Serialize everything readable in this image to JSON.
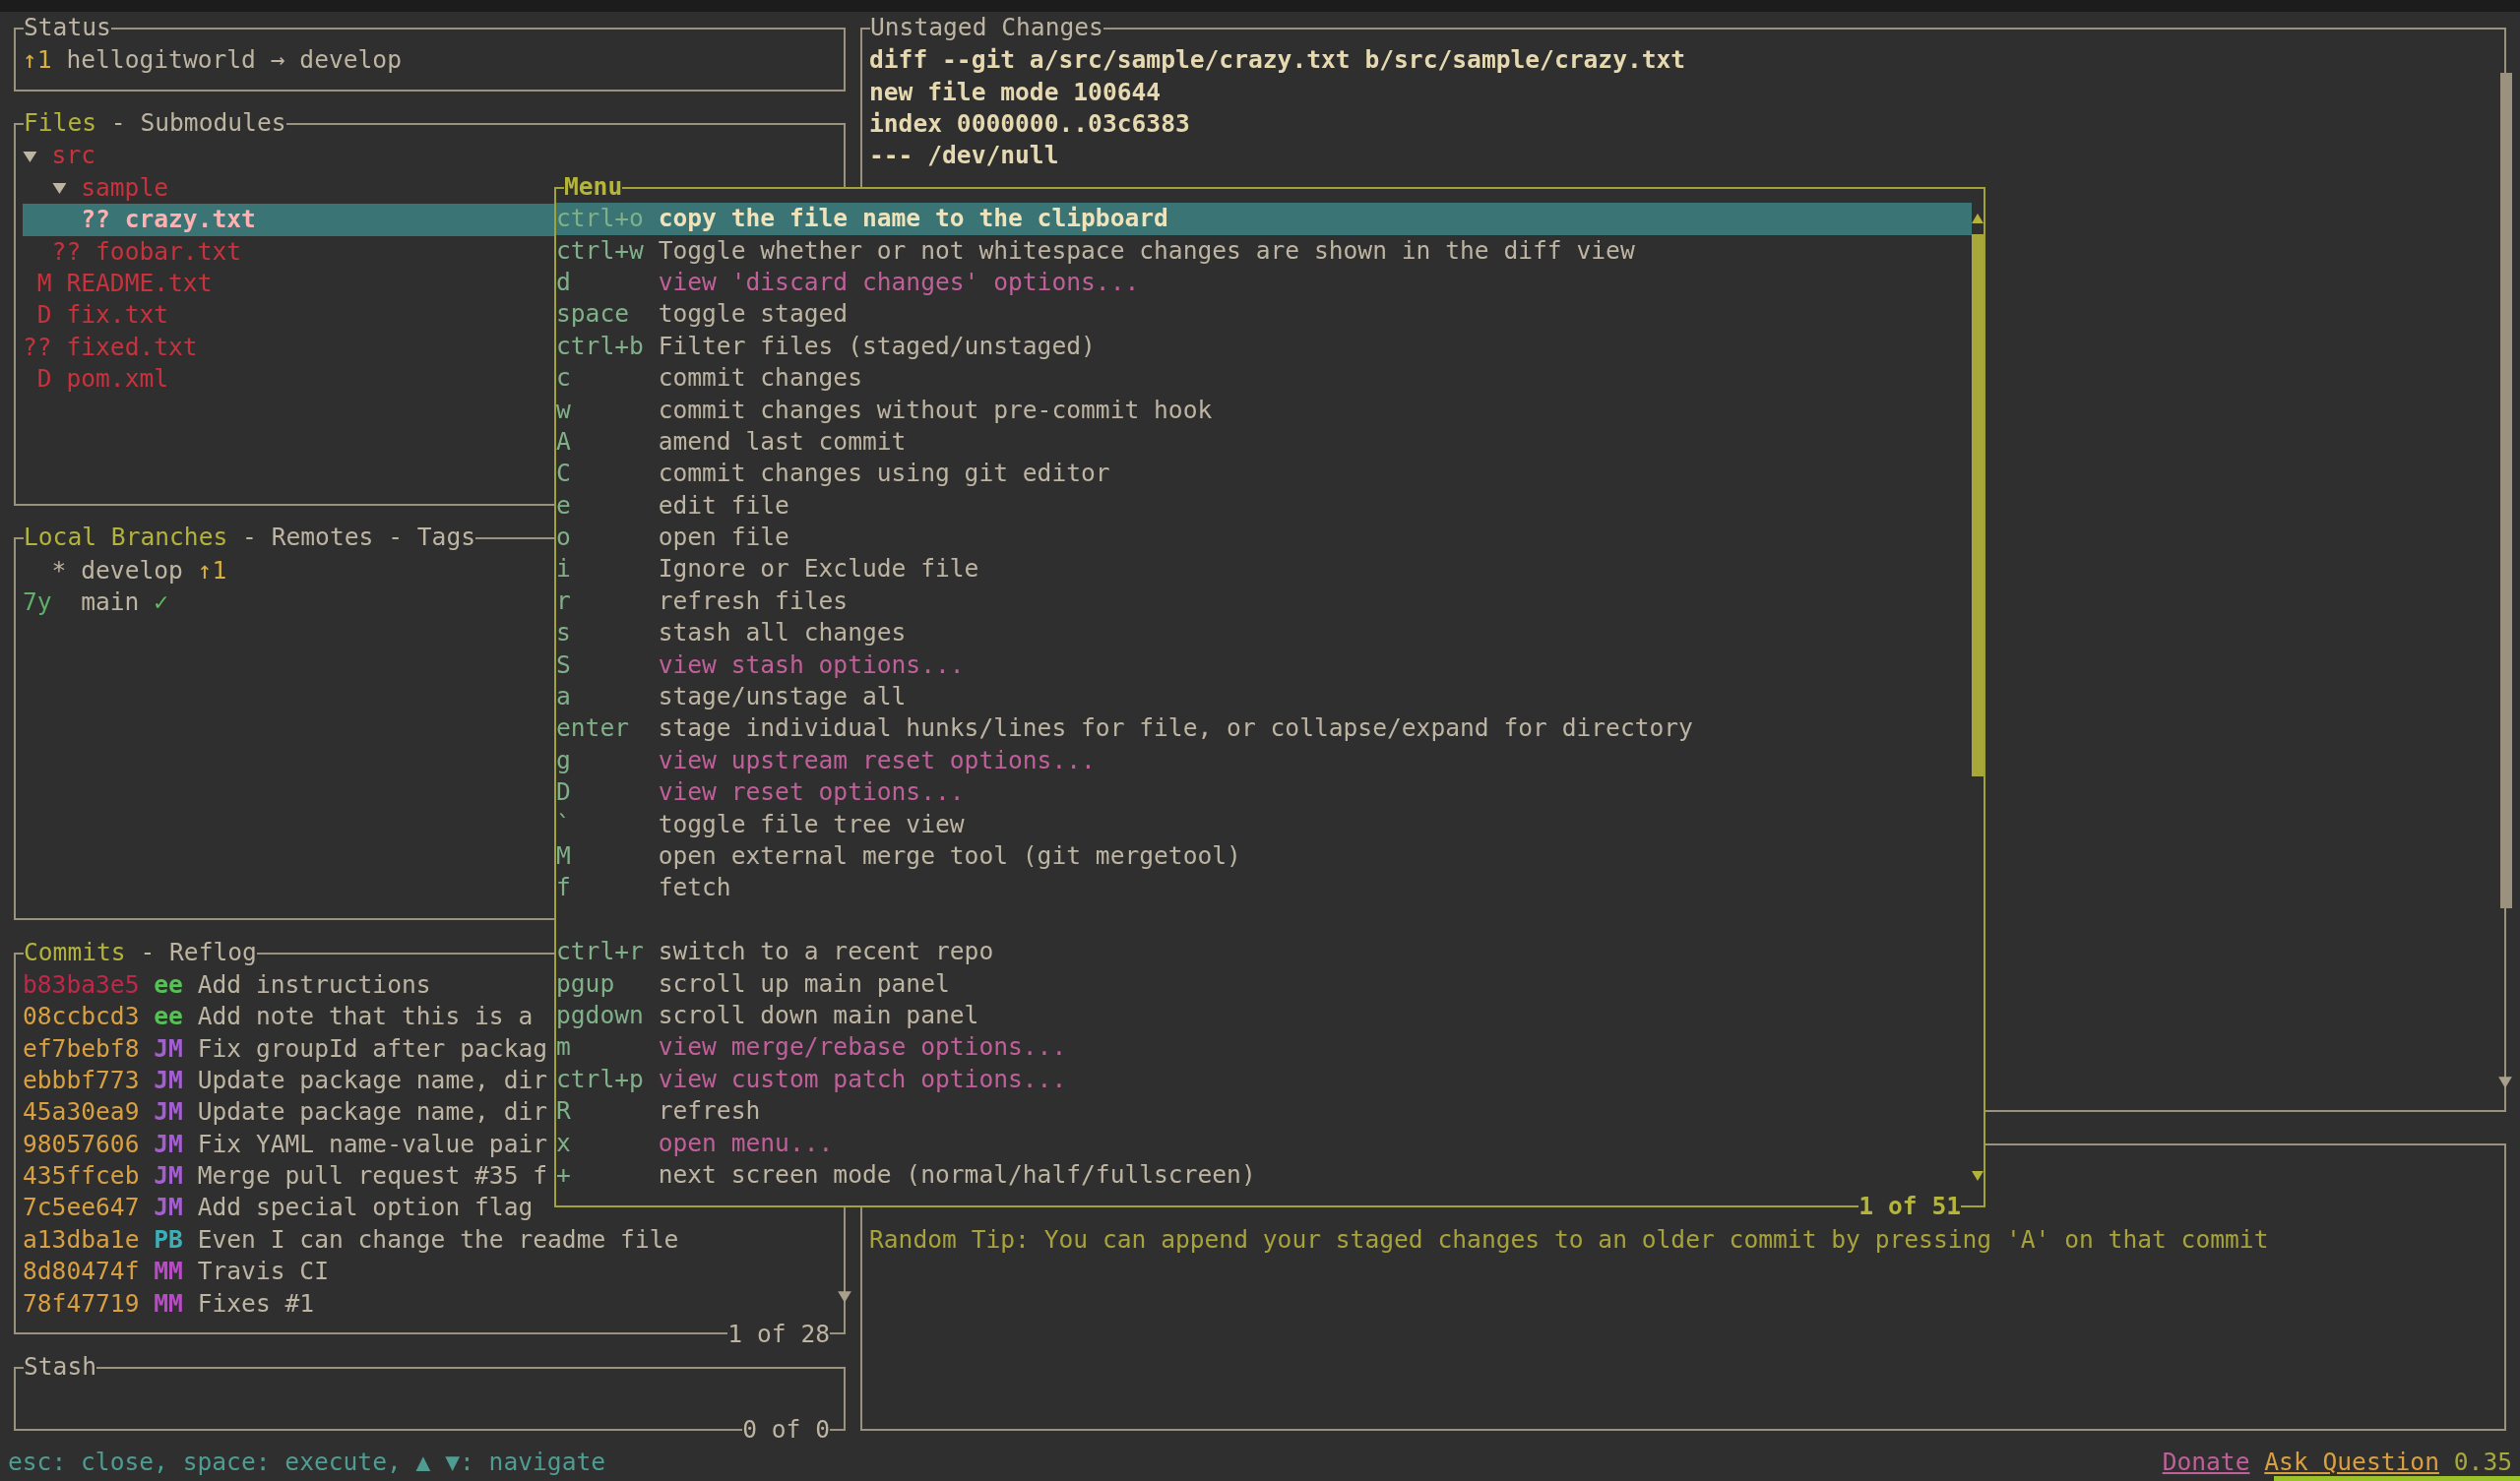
{
  "status_panel": {
    "title": "Status",
    "ahead": "↑1",
    "text": "hellogitworld → develop"
  },
  "files_panel": {
    "tabs": [
      {
        "label": "Files",
        "selected": true
      },
      {
        "label": "Submodules",
        "selected": false,
        "separator": "-"
      }
    ],
    "items": [
      {
        "kind": "folder",
        "name": "src",
        "expanded": true,
        "selected": false,
        "children": [
          {
            "kind": "folder",
            "name": "sample",
            "expanded": true,
            "selected": false,
            "children": [
              {
                "kind": "file",
                "status": "??",
                "name": "crazy.txt",
                "selected": true
              }
            ]
          },
          {
            "kind": "file",
            "status": "??",
            "name": "foobar.txt",
            "selected": false
          }
        ]
      },
      {
        "kind": "file",
        "status": "M",
        "name": "README.txt",
        "selected": false
      },
      {
        "kind": "file",
        "status": "D",
        "name": "fix.txt",
        "selected": false
      },
      {
        "kind": "file",
        "status": "??",
        "name": "fixed.txt",
        "selected": false
      },
      {
        "kind": "file",
        "status": "D",
        "name": "pom.xml",
        "selected": false
      }
    ]
  },
  "branches_panel": {
    "tabs": [
      {
        "label": "Local Branches",
        "selected": true
      },
      {
        "label": "Remotes",
        "selected": false,
        "separator": "-"
      },
      {
        "label": "Tags",
        "selected": false,
        "separator": "-"
      }
    ],
    "items": [
      {
        "marker": "*",
        "name": "develop",
        "track": "↑1",
        "color": "#d8b040"
      },
      {
        "age": "7y",
        "name": "main",
        "track": "✓",
        "color": "#5fbf5f"
      }
    ]
  },
  "commits_panel": {
    "tabs": [
      {
        "label": "Commits",
        "selected": true
      },
      {
        "label": "Reflog",
        "selected": false,
        "separator": "-"
      }
    ],
    "items": [
      {
        "hash": "b83ba3e5",
        "pushed": false,
        "author": "ee",
        "color": "#56c256",
        "message": "Add instructions"
      },
      {
        "hash": "08ccbcd3",
        "pushed": true,
        "author": "ee",
        "color": "#56c256",
        "message": "Add note that this is a"
      },
      {
        "hash": "ef7bebf8",
        "pushed": true,
        "author": "JM",
        "color": "#a35fd0",
        "message": "Fix groupId after packag"
      },
      {
        "hash": "ebbbf773",
        "pushed": true,
        "author": "JM",
        "color": "#a35fd0",
        "message": "Update package name, dir"
      },
      {
        "hash": "45a30ea9",
        "pushed": true,
        "author": "JM",
        "color": "#a35fd0",
        "message": "Update package name, dir"
      },
      {
        "hash": "98057606",
        "pushed": true,
        "author": "JM",
        "color": "#a35fd0",
        "message": "Fix YAML name-value pair"
      },
      {
        "hash": "435ffceb",
        "pushed": true,
        "author": "JM",
        "color": "#a35fd0",
        "message": "Merge pull request #35 f"
      },
      {
        "hash": "7c5ee647",
        "pushed": true,
        "author": "JM",
        "color": "#a35fd0",
        "message": "Add special option flag"
      },
      {
        "hash": "a13dba1e",
        "pushed": true,
        "author": "PB",
        "color": "#3cb0b8",
        "message": "Even I can change the readme file"
      },
      {
        "hash": "8d80474f",
        "pushed": true,
        "author": "MM",
        "color": "#b84cc4",
        "message": "Travis CI"
      },
      {
        "hash": "78f47719",
        "pushed": true,
        "author": "MM",
        "color": "#b84cc4",
        "message": "Fixes #1"
      }
    ],
    "counter": "1 of 28"
  },
  "stash_panel": {
    "title": "Stash",
    "counter": "0 of 0"
  },
  "diff_panel": {
    "title": "Unstaged Changes",
    "lines": [
      "diff --git a/src/sample/crazy.txt b/src/sample/crazy.txt",
      "new file mode 100644",
      "index 0000000..03c6383",
      "--- /dev/null"
    ]
  },
  "tip_panel": {
    "text": "Random Tip: You can append your staged changes to an older commit by pressing 'A' on that commit"
  },
  "menu": {
    "title": "Menu",
    "counter": "1 of 51",
    "items": [
      {
        "kind": "command",
        "key": "ctrl+o",
        "label": "copy the file name to the clipboard",
        "selected": true
      },
      {
        "kind": "command",
        "key": "ctrl+w",
        "label": "Toggle whether or not whitespace changes are shown in the diff view",
        "selected": false
      },
      {
        "kind": "submenu",
        "key": "d",
        "label": "view 'discard changes' options...",
        "selected": false
      },
      {
        "kind": "command",
        "key": "space",
        "label": "toggle staged",
        "selected": false
      },
      {
        "kind": "command",
        "key": "ctrl+b",
        "label": "Filter files (staged/unstaged)",
        "selected": false
      },
      {
        "kind": "command",
        "key": "c",
        "label": "commit changes",
        "selected": false
      },
      {
        "kind": "command",
        "key": "w",
        "label": "commit changes without pre-commit hook",
        "selected": false
      },
      {
        "kind": "command",
        "key": "A",
        "label": "amend last commit",
        "selected": false
      },
      {
        "kind": "command",
        "key": "C",
        "label": "commit changes using git editor",
        "selected": false
      },
      {
        "kind": "command",
        "key": "e",
        "label": "edit file",
        "selected": false
      },
      {
        "kind": "command",
        "key": "o",
        "label": "open file",
        "selected": false
      },
      {
        "kind": "command",
        "key": "i",
        "label": "Ignore or Exclude file",
        "selected": false
      },
      {
        "kind": "command",
        "key": "r",
        "label": "refresh files",
        "selected": false
      },
      {
        "kind": "command",
        "key": "s",
        "label": "stash all changes",
        "selected": false
      },
      {
        "kind": "submenu",
        "key": "S",
        "label": "view stash options...",
        "selected": false
      },
      {
        "kind": "command",
        "key": "a",
        "label": "stage/unstage all",
        "selected": false
      },
      {
        "kind": "command",
        "key": "enter",
        "label": "stage individual hunks/lines for file, or collapse/expand for directory",
        "selected": false
      },
      {
        "kind": "submenu",
        "key": "g",
        "label": "view upstream reset options...",
        "selected": false
      },
      {
        "kind": "submenu",
        "key": "D",
        "label": "view reset options...",
        "selected": false
      },
      {
        "kind": "command",
        "key": "`",
        "label": "toggle file tree view",
        "selected": false
      },
      {
        "kind": "command",
        "key": "M",
        "label": "open external merge tool (git mergetool)",
        "selected": false
      },
      {
        "kind": "command",
        "key": "f",
        "label": "fetch",
        "selected": false
      },
      {
        "kind": "spacer"
      },
      {
        "kind": "command",
        "key": "ctrl+r",
        "label": "switch to a recent repo",
        "selected": false
      },
      {
        "kind": "command",
        "key": "pgup",
        "label": "scroll up main panel",
        "selected": false
      },
      {
        "kind": "command",
        "key": "pgdown",
        "label": "scroll down main panel",
        "selected": false
      },
      {
        "kind": "submenu",
        "key": "m",
        "label": "view merge/rebase options...",
        "selected": false
      },
      {
        "kind": "submenu",
        "key": "ctrl+p",
        "label": "view custom patch options...",
        "selected": false
      },
      {
        "kind": "command",
        "key": "R",
        "label": "refresh",
        "selected": false
      },
      {
        "kind": "submenu",
        "key": "x",
        "label": "open menu...",
        "selected": false
      },
      {
        "kind": "command",
        "key": "+",
        "label": "next screen mode (normal/half/fullscreen)",
        "selected": false
      }
    ]
  },
  "footer": {
    "hint": "esc: close, space: execute, ▲ ▼: navigate",
    "links": [
      {
        "label": "Donate",
        "kind": "donate"
      },
      {
        "label": "Ask Question",
        "kind": "question"
      }
    ],
    "version": "0.35"
  }
}
